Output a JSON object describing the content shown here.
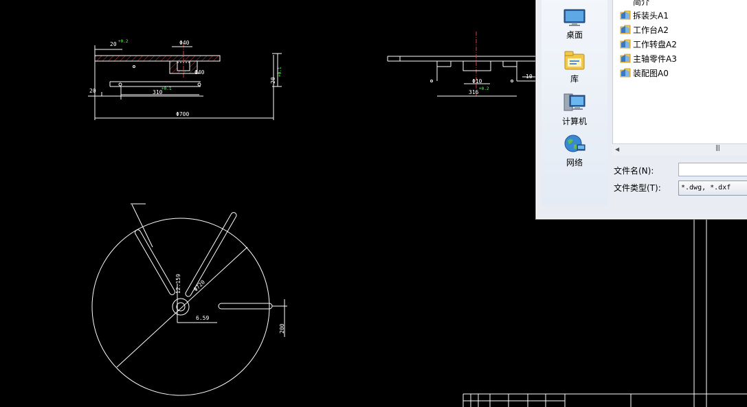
{
  "drawing": {
    "top_view_dims": {
      "d20_tol": "20",
      "d20_tol_sup": "+0.2",
      "phi40_top": "Φ40",
      "phi40_mid": "Φ40",
      "right_dim": "20",
      "right_dim_sup": "+0.1",
      "d20_left": "20",
      "d310": "310",
      "d310_tol": "+0.1",
      "phi700": "Φ700"
    },
    "side_view_dims": {
      "phi10": "Φ10",
      "d10": "10",
      "d316": "316",
      "d316_tol": "+0.2"
    },
    "plan_view_dims": {
      "phi720": "Φ720",
      "d12_159": "12.159",
      "d6_59": "6.59",
      "d200": "200"
    }
  },
  "dialog": {
    "places": [
      {
        "label": "桌面",
        "icon": "desktop-icon"
      },
      {
        "label": "库",
        "icon": "library-icon"
      },
      {
        "label": "计算机",
        "icon": "computer-icon"
      },
      {
        "label": "网络",
        "icon": "network-icon"
      }
    ],
    "files": [
      {
        "label": "简介"
      },
      {
        "label": "拆装头A1"
      },
      {
        "label": "工作台A2"
      },
      {
        "label": "工作转盘A2"
      },
      {
        "label": "主轴零件A3"
      },
      {
        "label": "装配图A0"
      }
    ],
    "filename_label": "文件名(N):",
    "filename_value": "",
    "filetype_label": "文件类型(T):",
    "filetype_value": "*.dwg, *.dxf"
  }
}
